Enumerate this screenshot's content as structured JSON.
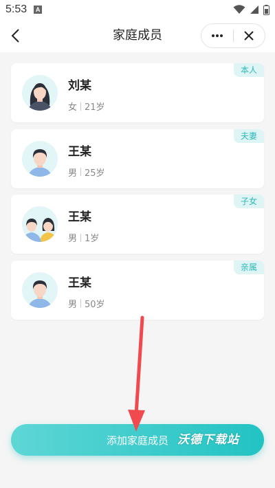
{
  "status_bar": {
    "time": "5:53",
    "notification_icon": "A"
  },
  "nav": {
    "title": "家庭成员"
  },
  "members": [
    {
      "name": "刘某",
      "gender": "女",
      "age": "21岁",
      "relation": "本人",
      "avatar": "female-avatar-icon"
    },
    {
      "name": "王某",
      "gender": "男",
      "age": "25岁",
      "relation": "夫妻",
      "avatar": "male-avatar-icon"
    },
    {
      "name": "王某",
      "gender": "男",
      "age": "1岁",
      "relation": "子女",
      "avatar": "children-avatar-icon"
    },
    {
      "name": "王某",
      "gender": "男",
      "age": "50岁",
      "relation": "亲属",
      "avatar": "male-avatar-icon"
    }
  ],
  "add_button": {
    "label": "添加家庭成员"
  },
  "watermark": {
    "text": "沃德下载站"
  },
  "colors": {
    "accent": "#22c3c3",
    "tag_bg": "#dff5f5",
    "arrow": "#f04a4f"
  }
}
